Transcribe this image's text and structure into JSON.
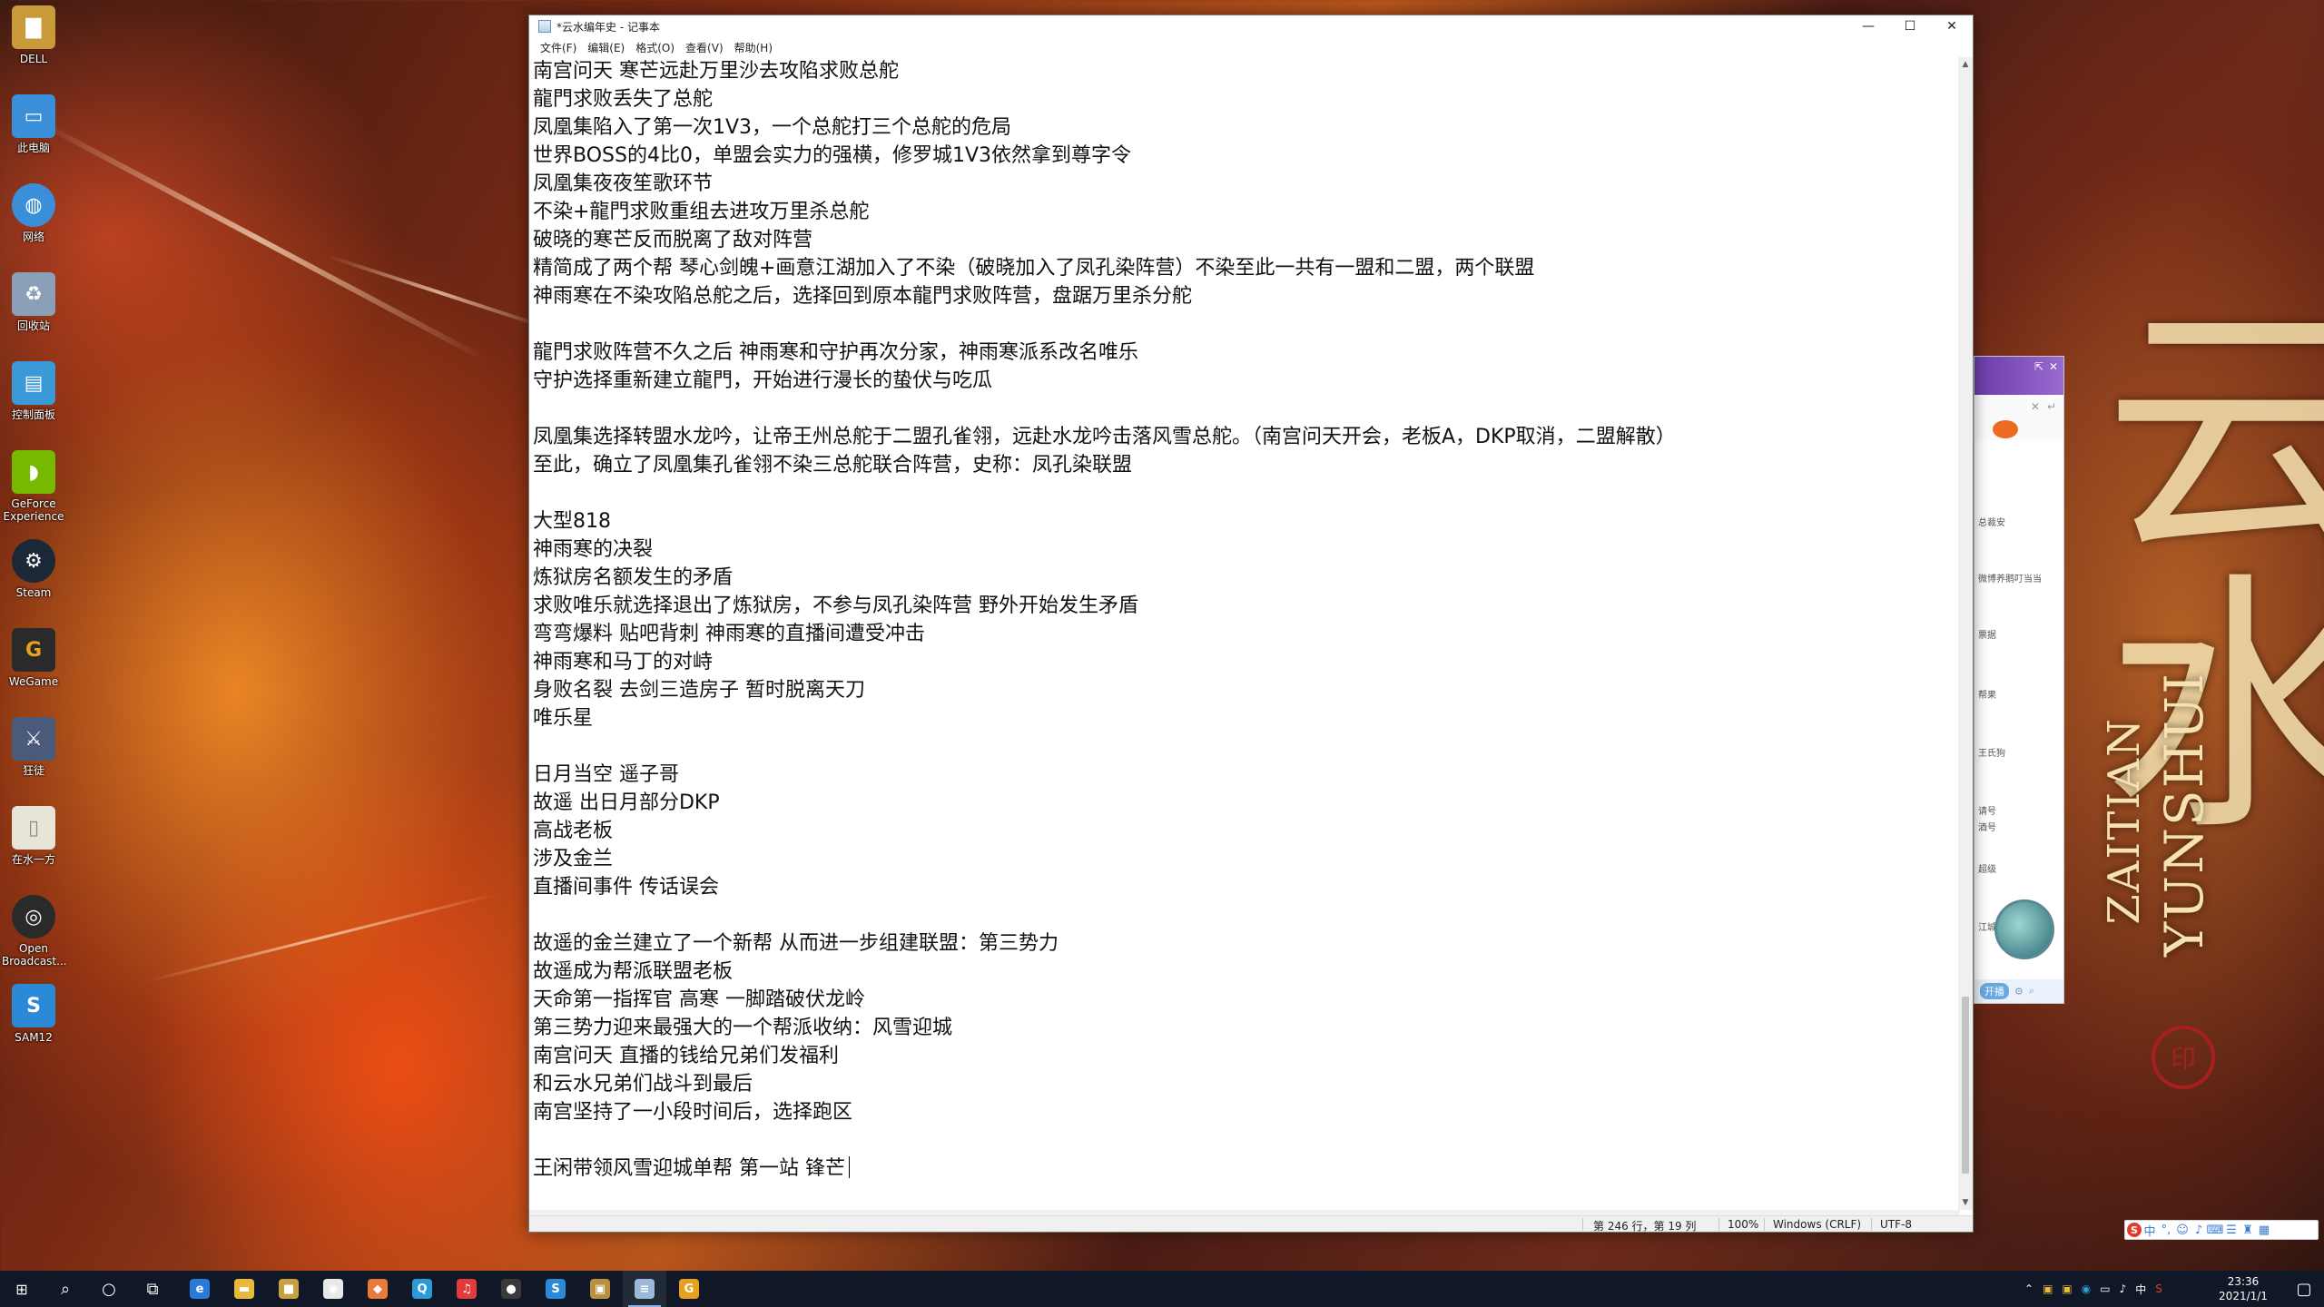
{
  "desktop": {
    "icons": [
      {
        "label": "DELL",
        "icon": "folder-icon",
        "color": "#c89a3a"
      },
      {
        "label": "此电脑",
        "icon": "computer-icon",
        "color": "#3a8fd8"
      },
      {
        "label": "网络",
        "icon": "network-icon",
        "color": "#3a8fd8"
      },
      {
        "label": "回收站",
        "icon": "recycle-bin-icon",
        "color": "#8aa0b8"
      },
      {
        "label": "控制面板",
        "icon": "control-panel-icon",
        "color": "#3a9ad8"
      },
      {
        "label": "GeForce Experience",
        "icon": "geforce-icon",
        "color": "#76b900"
      },
      {
        "label": "Steam",
        "icon": "steam-icon",
        "color": "#1b2838"
      },
      {
        "label": "WeGame",
        "icon": "wegame-icon",
        "color": "#2a2a2a"
      },
      {
        "label": "狂徒",
        "icon": "game-shortcut-icon",
        "color": "#4a5a7a"
      },
      {
        "label": "在水一方",
        "icon": "document-icon",
        "color": "#e8e4d8"
      },
      {
        "label": "Open Broadcast...",
        "icon": "obs-icon",
        "color": "#2a2a2a"
      },
      {
        "label": "SAM12",
        "icon": "sam-icon",
        "color": "#2a8ad8"
      }
    ]
  },
  "wallpaper": {
    "art_letters_1": "YUNSHUI",
    "art_letters_2": "ZAITIAN",
    "art_big_chars": "云水",
    "seal": "印"
  },
  "notepad": {
    "title": "*云水编年史 - 记事本",
    "window_buttons": {
      "minimize": "—",
      "maximize": "☐",
      "close": "✕"
    },
    "menu": [
      "文件(F)",
      "编辑(E)",
      "格式(O)",
      "查看(V)",
      "帮助(H)"
    ],
    "lines": [
      "南宫问天 寒芒远赴万里沙去攻陷求败总舵",
      "龍門求败丢失了总舵",
      "凤凰集陷入了第一次1V3，一个总舵打三个总舵的危局",
      "世界BOSS的4比0，单盟会实力的强横，修罗城1V3依然拿到尊字令",
      "凤凰集夜夜笙歌环节",
      "不染+龍門求败重组去进攻万里杀总舵",
      "破晓的寒芒反而脱离了敌对阵营",
      "精简成了两个帮 琴心剑魄+画意江湖加入了不染（破晓加入了凤孔染阵营）不染至此一共有一盟和二盟，两个联盟",
      "神雨寒在不染攻陷总舵之后，选择回到原本龍門求败阵营，盘踞万里杀分舵",
      "",
      "龍門求败阵营不久之后 神雨寒和守护再次分家，神雨寒派系改名唯乐",
      "守护选择重新建立龍門，开始进行漫长的蛰伏与吃瓜",
      "",
      "凤凰集选择转盟水龙吟，让帝王州总舵于二盟孔雀翎，远赴水龙吟击落风雪总舵。（南宫问天开会，老板A，DKP取消，二盟解散）",
      "至此，确立了凤凰集孔雀翎不染三总舵联合阵营，史称：凤孔染联盟",
      "",
      "大型818",
      "神雨寒的决裂",
      "炼狱房名额发生的矛盾",
      "求败唯乐就选择退出了炼狱房，不参与凤孔染阵营 野外开始发生矛盾",
      "弯弯爆料 贴吧背刺 神雨寒的直播间遭受冲击",
      "神雨寒和马丁的对峙",
      "身败名裂 去剑三造房子 暂时脱离天刀",
      "唯乐星",
      "",
      "日月当空 遥子哥",
      "故遥 出日月部分DKP",
      "高战老板",
      "涉及金兰",
      "直播间事件 传话误会",
      "",
      "故遥的金兰建立了一个新帮 从而进一步组建联盟：第三势力",
      "故遥成为帮派联盟老板",
      "天命第一指挥官 高寒 一脚踏破伏龙岭",
      "第三势力迎来最强大的一个帮派收纳：风雪迎城",
      "南宫问天 直播的钱给兄弟们发福利",
      "和云水兄弟们战斗到最后",
      "南宫坚持了一小段时间后，选择跑区",
      "",
      "王闲带领风雪迎城单帮 第一站 锋芒"
    ],
    "status": {
      "position": "第 246 行，第 19 列",
      "zoom": "100%",
      "line_ending": "Windows (CRLF)",
      "encoding": "UTF-8"
    }
  },
  "widget": {
    "items": [
      "总裁安",
      "微博养鹅叮当当",
      "票据",
      "帮果",
      "王氏狗",
      "请号",
      "酒号",
      "超级",
      "江城"
    ],
    "bottom": [
      "开播"
    ]
  },
  "ime": {
    "label_cn": "中",
    "punct": "°,",
    "sogou": "S"
  },
  "taskbar": {
    "start": "start-icon",
    "search": "search-icon",
    "cortana": "cortana-icon",
    "task_view": "task-view-icon",
    "apps": [
      {
        "name": "edge",
        "glyph": "e",
        "color": "#2a7ad8"
      },
      {
        "name": "file-explorer",
        "glyph": "▬",
        "color": "#e8b93a"
      },
      {
        "name": "app-3",
        "glyph": "■",
        "color": "#c8a040"
      },
      {
        "name": "app-4",
        "glyph": "◉",
        "color": "#e8e8e8"
      },
      {
        "name": "app-5",
        "glyph": "◆",
        "color": "#e87a3a"
      },
      {
        "name": "qq-browser",
        "glyph": "Q",
        "color": "#2a9ad8"
      },
      {
        "name": "netease-music",
        "glyph": "♫",
        "color": "#e23b3b"
      },
      {
        "name": "obs",
        "glyph": "●",
        "color": "#3a3a3a"
      },
      {
        "name": "sam",
        "glyph": "S",
        "color": "#2a8ad8"
      },
      {
        "name": "game-folder",
        "glyph": "▣",
        "color": "#b89040"
      },
      {
        "name": "notepad",
        "glyph": "≡",
        "color": "#9ab8d8"
      },
      {
        "name": "wegame",
        "glyph": "G",
        "color": "#e8a020"
      }
    ],
    "tray_lang": "中",
    "clock_time": "23:36",
    "clock_date": "2021/1/1"
  }
}
